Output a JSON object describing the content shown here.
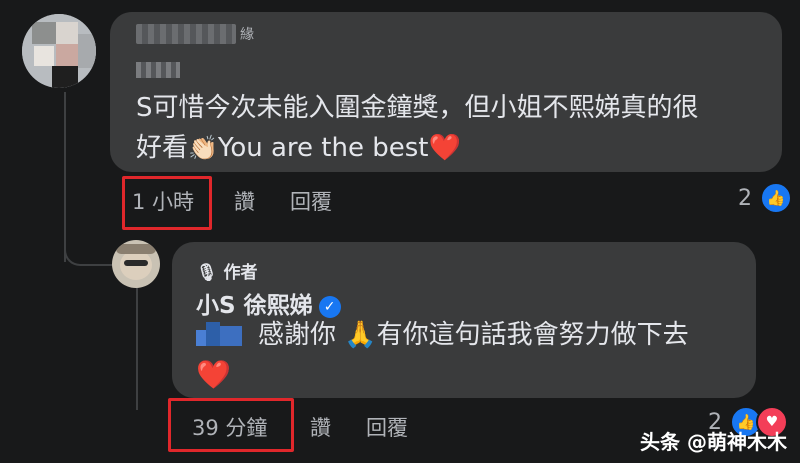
{
  "comment": {
    "name_fragment": "緣",
    "text_line1": "S可惜今次未能入圍金鐘獎，但小姐不熙娣真的很",
    "text_line2_prefix": "好看",
    "clap_emoji": "👏🏻",
    "text_line2_suffix": "You are the best",
    "heart_emoji": "❤️",
    "timestamp": "1 小時",
    "like_action": "讚",
    "reply_action": "回覆",
    "reaction_count": "2"
  },
  "reply": {
    "author_badge": "作者",
    "name": "小S 徐熙娣",
    "text_part1": "感謝你",
    "pray_emoji": "🙏",
    "text_part2": "有你這句話我會努力做下去",
    "heart_emoji": "❤️",
    "timestamp": "39 分鐘",
    "like_action": "讚",
    "reply_action": "回覆",
    "reaction_count": "2"
  },
  "watermark": "头条 @萌神木木",
  "colors": {
    "background": "#18191a",
    "bubble": "#3a3b3c",
    "highlight": "#e0272b",
    "like": "#1877f2",
    "love": "#f33e58"
  },
  "icons": [
    "like-icon",
    "love-icon",
    "verified-icon",
    "microphone-icon"
  ]
}
